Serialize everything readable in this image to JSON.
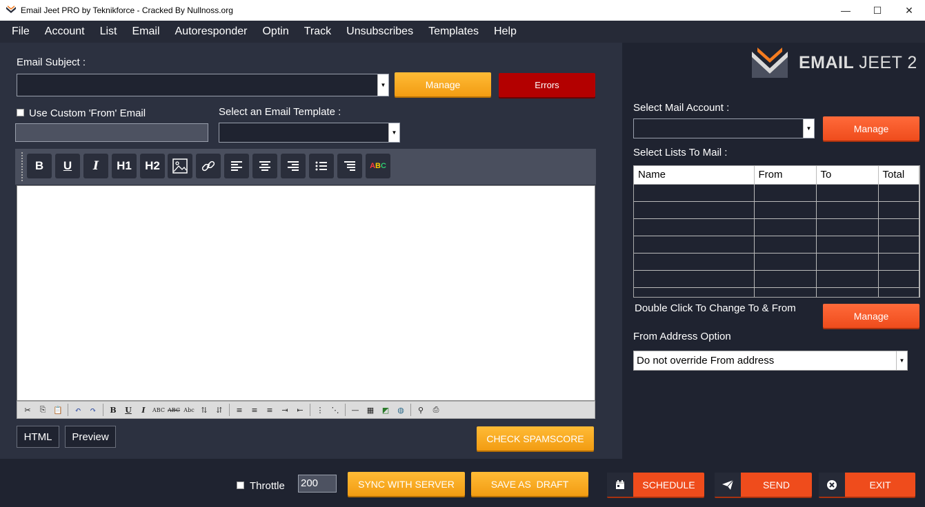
{
  "window": {
    "title": "Email Jeet PRO by Teknikforce - Cracked By Nullnoss.org",
    "minimize": "—",
    "maximize": "☐",
    "close": "✕"
  },
  "menu": [
    "File",
    "Account",
    "List",
    "Email",
    "Autoresponder",
    "Optin",
    "Track",
    "Unsubscribes",
    "Templates",
    "Help"
  ],
  "subject": {
    "label": "Email Subject :",
    "value": "",
    "manage_label": "Manage",
    "errors_label": "Errors"
  },
  "custom_from": {
    "label": "Use Custom 'From' Email",
    "checked": false,
    "value": ""
  },
  "template": {
    "label": "Select an Email Template :",
    "value": ""
  },
  "editor_toolbar": {
    "bold": "B",
    "underline": "U",
    "italic": "I",
    "h1": "H1",
    "h2": "H2",
    "spellcheck": "ABC"
  },
  "editor_tabs": {
    "html": "HTML",
    "preview": "Preview"
  },
  "check_spamscore_label": "CHECK SPAMSCORE",
  "logo": {
    "brand": "EMAIL",
    "product": "JEET 2"
  },
  "mail_account": {
    "label": "Select Mail Account :",
    "value": "",
    "manage_label": "Manage"
  },
  "lists": {
    "label": "Select Lists To Mail :",
    "columns": [
      "Name",
      "From",
      "To",
      "Total"
    ],
    "hint": "Double Click To Change To & From",
    "manage_label": "Manage"
  },
  "from_address": {
    "label": "From Address Option",
    "value": "Do not override From address"
  },
  "bottom": {
    "throttle_label": "Throttle",
    "throttle_checked": false,
    "throttle_value": "200",
    "sync_label": "SYNC WITH SERVER",
    "save_draft_label": "SAVE AS  DRAFT",
    "schedule_label": "SCHEDULE",
    "send_label": "SEND",
    "exit_label": "EXIT"
  },
  "colors": {
    "accent_yellow": "#f29c12",
    "accent_orange": "#ef4c1c",
    "errors_red": "#b30000",
    "panel_bg": "#2c3140",
    "app_bg": "#1f2330"
  }
}
